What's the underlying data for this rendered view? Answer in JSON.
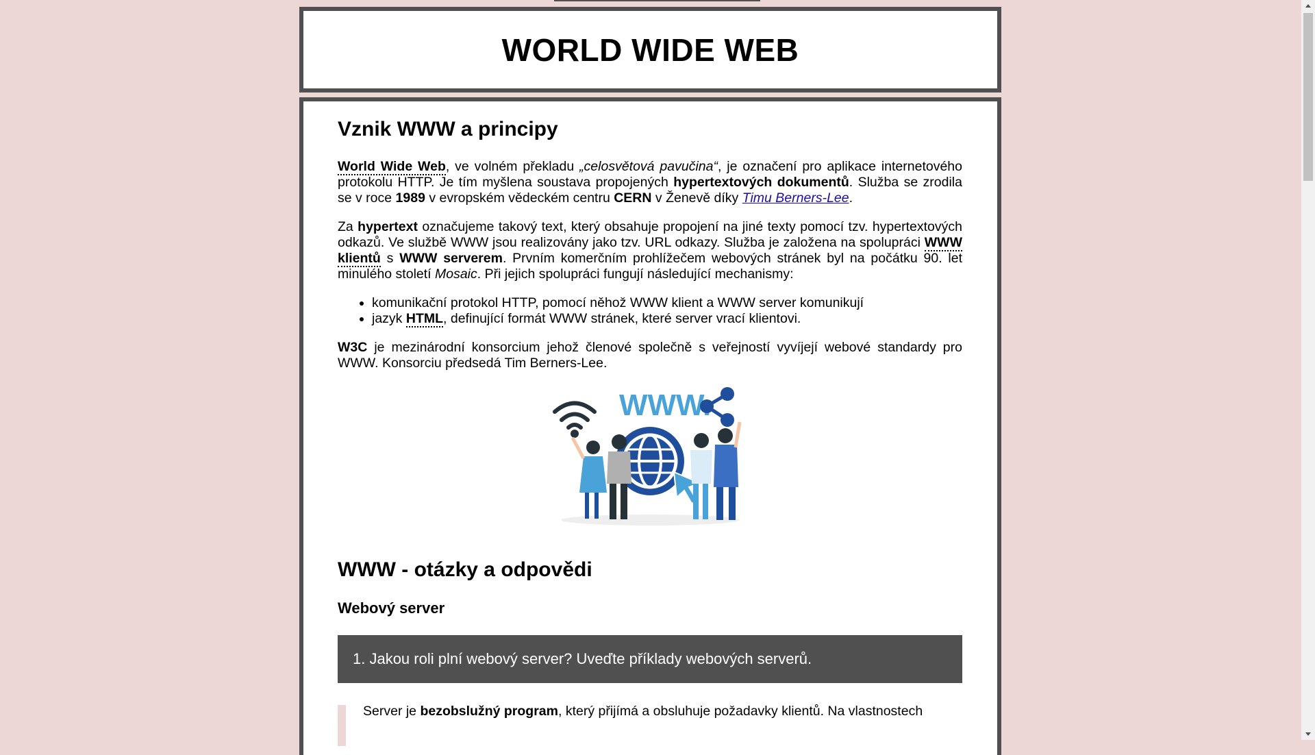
{
  "header": {
    "title": "WORLD WIDE WEB"
  },
  "section1": {
    "heading": "Vznik WWW a principy",
    "p1": {
      "t1": "World Wide Web",
      "t2": ", ve volném překladu ",
      "t3": "„celosvětová pavučina“",
      "t4": ", je označení pro aplikace internetového protokolu HTTP. Je tím myšlena soustava propojených ",
      "t5": "hypertextových dokumentů",
      "t6": ". Služba se zrodila se v roce ",
      "t7": "1989",
      "t8": " v evropském vědeckém centru ",
      "t9": "CERN",
      "t10": " v Ženevě díky ",
      "link": "Timu Berners-Lee",
      "t11": "."
    },
    "p2": {
      "t1": "Za ",
      "t2": "hypertext",
      "t3": " označujeme takový text, který obsahuje propojení na jiné texty pomocí tzv. hypertextových odkazů. Ve službě WWW jsou realizovány jako tzv. URL odkazy. Služba je založena na spolupráci ",
      "t4": "WWW klientů",
      "t5": " s ",
      "t6": "WWW serverem",
      "t7": ". Prvním komerčním prohlížečem webových stránek byl na počátku 90. let minulého století ",
      "t8": "Mosaic",
      "t9": ". Při jejich spolupráci fungují následující mechanismy:"
    },
    "list": {
      "item1": "komunikační protokol HTTP, pomocí něhož WWW klient a WWW server komunikují",
      "item2a": "jazyk ",
      "item2b": "HTML",
      "item2c": ", definující formát WWW stránek, které server vrací klientovi."
    },
    "p3": {
      "t1": "W3C",
      "t2": " je mezinárodní konsorcium jehož členové společně s veřejností vyvíjejí webové standardy pro WWW. Konsorciu předsedá Tim Berners-Lee."
    },
    "illustration": {
      "text": "WWW.",
      "icons": [
        "wifi-icon",
        "globe-icon",
        "share-icon",
        "cursor-icon"
      ]
    }
  },
  "section2": {
    "heading": "WWW - otázky a odpovědi",
    "subheading": "Webový server",
    "question": "1. Jakou roli plní webový server? Uveďte příklady webových serverů.",
    "answer": {
      "t1": "Server je ",
      "t2": "bezobslužný program",
      "t3": ", který přijímá a obsluhuje požadavky klientů. Na vlastnostech"
    }
  },
  "colors": {
    "background": "#ecd6d6",
    "border": "#505050",
    "link": "#1a0dab",
    "accent_blue": "#1f4e9c",
    "light_blue": "#4aa3d8"
  }
}
